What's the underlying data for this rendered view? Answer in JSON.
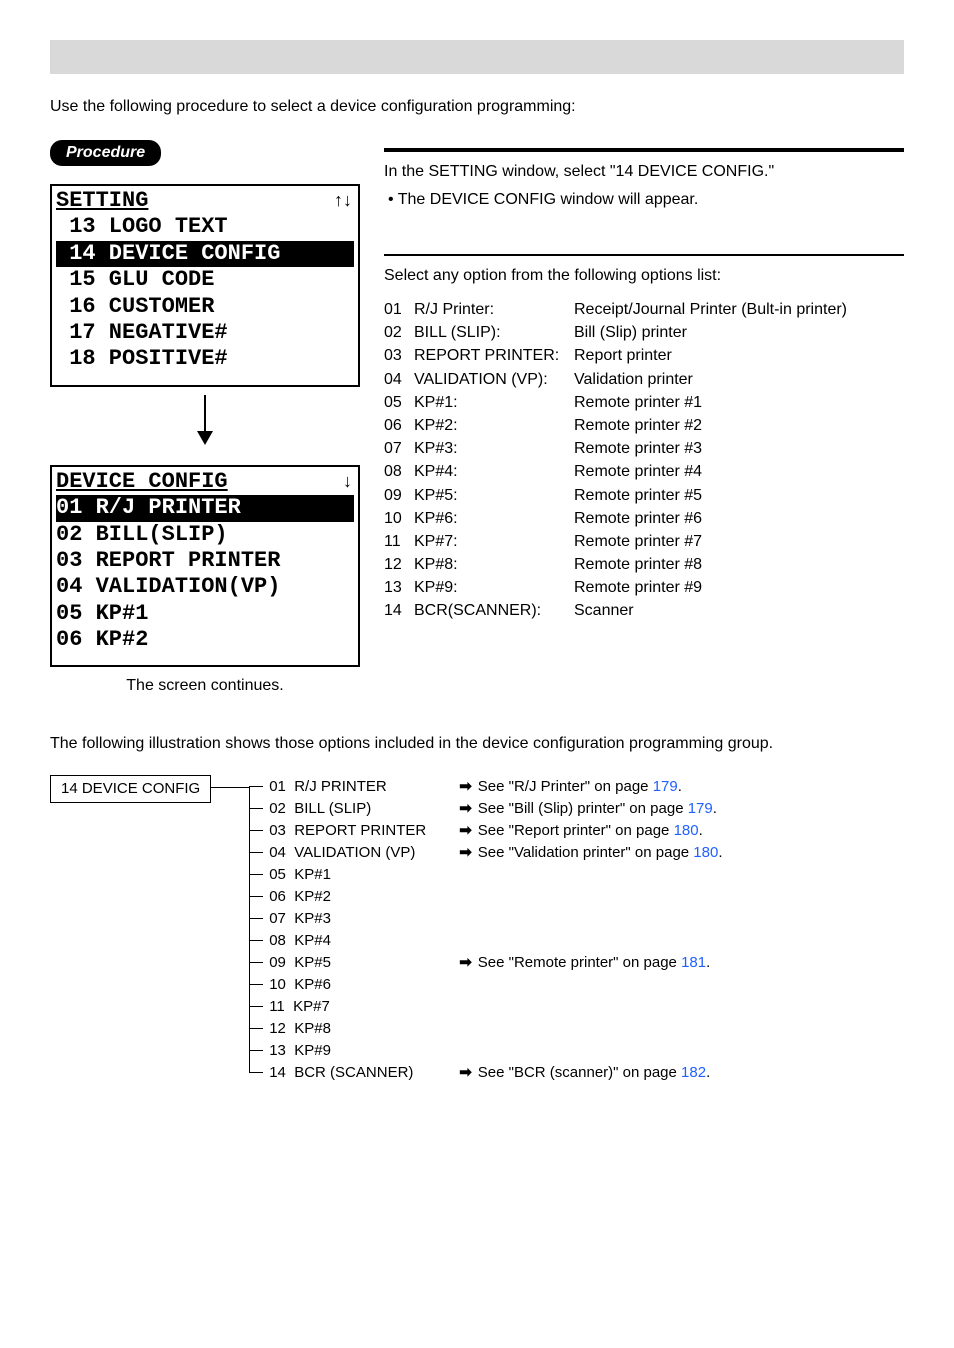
{
  "intro": "Use the following procedure to select a device configuration programming:",
  "procedure_label": "Procedure",
  "step1": {
    "main": "In the SETTING window, select \"14 DEVICE CONFIG.\"",
    "bullet": "•  The DEVICE CONFIG window will appear."
  },
  "step2": {
    "intro": "Select any option from the following options list:",
    "options": [
      {
        "n": "01",
        "name": "R/J Printer:",
        "desc": "Receipt/Journal Printer (Bult-in printer)"
      },
      {
        "n": "02",
        "name": "BILL (SLIP):",
        "desc": "Bill (Slip) printer"
      },
      {
        "n": "03",
        "name": "REPORT PRINTER:",
        "desc": "Report printer"
      },
      {
        "n": "04",
        "name": "VALIDATION (VP):",
        "desc": "Validation printer"
      },
      {
        "n": "05",
        "name": "KP#1:",
        "desc": "Remote printer #1"
      },
      {
        "n": "06",
        "name": "KP#2:",
        "desc": "Remote printer #2"
      },
      {
        "n": "07",
        "name": "KP#3:",
        "desc": "Remote printer #3"
      },
      {
        "n": "08",
        "name": "KP#4:",
        "desc": "Remote printer #4"
      },
      {
        "n": "09",
        "name": "KP#5:",
        "desc": "Remote printer #5"
      },
      {
        "n": "10",
        "name": "KP#6:",
        "desc": "Remote printer #6"
      },
      {
        "n": "11",
        "name": "KP#7:",
        "desc": "Remote printer #7"
      },
      {
        "n": "12",
        "name": "KP#8:",
        "desc": "Remote printer #8"
      },
      {
        "n": "13",
        "name": "KP#9:",
        "desc": "Remote printer #9"
      },
      {
        "n": "14",
        "name": "BCR(SCANNER):",
        "desc": "Scanner"
      }
    ]
  },
  "lcd1": {
    "title": "SETTING",
    "glyph": "↑↓",
    "rows": [
      {
        "t": " 13 LOGO TEXT",
        "hl": false
      },
      {
        "t": " 14 DEVICE CONFIG ",
        "hl": true
      },
      {
        "t": " 15 GLU CODE",
        "hl": false
      },
      {
        "t": " 16 CUSTOMER",
        "hl": false
      },
      {
        "t": " 17 NEGATIVE#",
        "hl": false
      },
      {
        "t": " 18 POSITIVE#",
        "hl": false
      }
    ]
  },
  "lcd2": {
    "title": "DEVICE CONFIG",
    "glyph": "↓",
    "rows": [
      {
        "t": "01 R/J PRINTER    ",
        "hl": true
      },
      {
        "t": "02 BILL(SLIP)",
        "hl": false
      },
      {
        "t": "03 REPORT PRINTER",
        "hl": false
      },
      {
        "t": "04 VALIDATION(VP)",
        "hl": false
      },
      {
        "t": "05 KP#1",
        "hl": false
      },
      {
        "t": "06 KP#2",
        "hl": false
      }
    ],
    "caption": "The screen continues."
  },
  "illustration_intro": "The following illustration shows those options included in the device configuration programming group.",
  "diagram": {
    "root": "14 DEVICE CONFIG",
    "items": [
      {
        "n": "01",
        "label": "R/J PRINTER",
        "ref": "See \"R/J Printer\" on page ",
        "page": "179",
        "tail": "."
      },
      {
        "n": "02",
        "label": "BILL (SLIP)",
        "ref": "See \"Bill (Slip) printer\" on page ",
        "page": "179",
        "tail": "."
      },
      {
        "n": "03",
        "label": "REPORT PRINTER",
        "ref": "See \"Report printer\" on page ",
        "page": "180",
        "tail": "."
      },
      {
        "n": "04",
        "label": "VALIDATION (VP)",
        "ref": "See \"Validation printer\" on page ",
        "page": "180",
        "tail": "."
      },
      {
        "n": "05",
        "label": "KP#1",
        "ref": "",
        "page": "",
        "tail": ""
      },
      {
        "n": "06",
        "label": "KP#2",
        "ref": "",
        "page": "",
        "tail": ""
      },
      {
        "n": "07",
        "label": "KP#3",
        "ref": "",
        "page": "",
        "tail": ""
      },
      {
        "n": "08",
        "label": "KP#4",
        "ref": "",
        "page": "",
        "tail": ""
      },
      {
        "n": "09",
        "label": "KP#5",
        "ref_group": "See \"Remote printer\" on page ",
        "page_group": "181",
        "tail_group": "."
      },
      {
        "n": "10",
        "label": "KP#6",
        "ref": "",
        "page": "",
        "tail": ""
      },
      {
        "n": "11",
        "label": "KP#7",
        "ref": "",
        "page": "",
        "tail": ""
      },
      {
        "n": "12",
        "label": "KP#8",
        "ref": "",
        "page": "",
        "tail": ""
      },
      {
        "n": "13",
        "label": "KP#9",
        "ref": "",
        "page": "",
        "tail": ""
      },
      {
        "n": "14",
        "label": "BCR (SCANNER)",
        "ref": "See \"BCR (scanner)\" on page ",
        "page": "182",
        "tail": "."
      }
    ]
  }
}
